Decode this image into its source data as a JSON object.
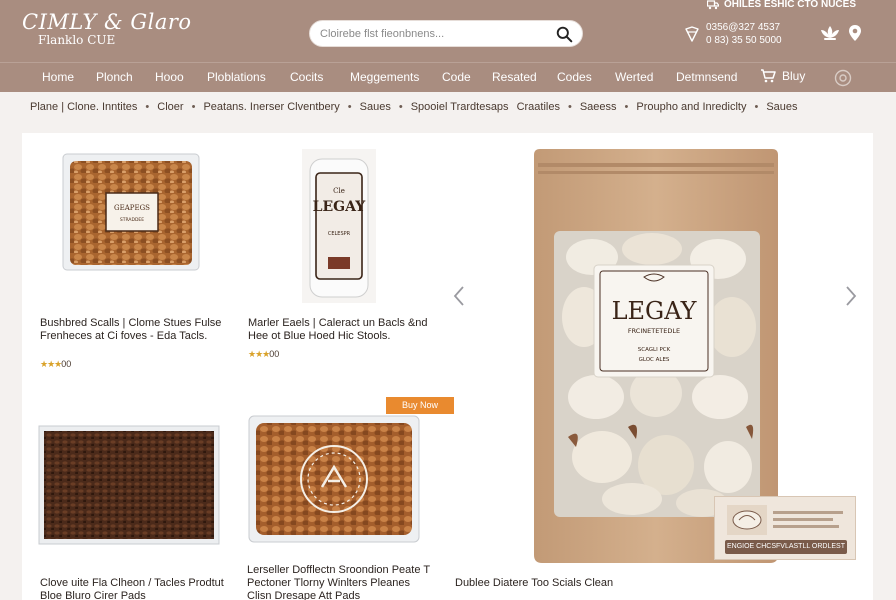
{
  "header": {
    "logo_title": "CIMLY & Glaro",
    "logo_subtitle": "Flanklo CUE",
    "search_placeholder": "Cloirebe flst fieonbnens...",
    "top_link": "OHILES ESHIC CTO NUCES",
    "phone_line1": "0356@327 4537",
    "phone_line2": "0 83) 35 50 5000"
  },
  "nav": {
    "items": [
      "Home",
      "Plonch",
      "Hooo",
      "Ploblations",
      "Cocits",
      "Meggements",
      "Code",
      "Resated",
      "Codes",
      "Werted",
      "Detmnsend"
    ],
    "cart_label": "Bluy"
  },
  "breadcrumb": {
    "items": [
      "Plane | Clone. Inntites",
      "Cloer",
      "Peatans. Inerser Clventbery",
      "Saues",
      "Spooiel Trardtesaps",
      "Craatiles",
      "Saeess",
      "Proupho and Inrediclty",
      "Saues"
    ]
  },
  "products": [
    {
      "name": "Bushbred Scalls | Clome Stues Fulse Frenheces at Ci foves - Eda Tacls.",
      "rating_stars": "★★★",
      "rating_value": "00"
    },
    {
      "name": "Marler Eaels | Caleract un Bacls &nd Hee ot Blue Hoed Hic Stools.",
      "rating_stars": "★★★",
      "rating_value": "00"
    },
    {
      "name": "Clove uite Fla Clheon / Tacles Prodtut Bloe Bluro Cirer Pads",
      "rating_stars": "",
      "rating_value": ""
    },
    {
      "name": "Lerseller Dofflectn Sroondion Peate T Pectoner Tlorny Winlters Pleanes Clisn Dresape Att Pads",
      "rating_stars": "",
      "rating_value": ""
    },
    {
      "name": "Dublee Diatere Too Scials Clean",
      "rating_stars": "",
      "rating_value": ""
    }
  ],
  "badge": {
    "label": "Buy Now"
  },
  "package_labels": {
    "bag1": "GEAPEGS",
    "bag1_sub": "STRADDEE",
    "bottle_top": "Cle",
    "bottle_main": "LEGAY",
    "bottle_sub": "CELESPR",
    "hero_main": "LEGAY",
    "hero_sub": "FRCINETETEDLE",
    "hero_small1": "SCAGLI PCK",
    "hero_small2": "GLOC ALES"
  },
  "thumbnail": {
    "label": "ENGIOE CHCSFVLASTLL ORDLEST"
  },
  "colors": {
    "header_bg": "#a98d80",
    "accent_orange": "#e98a2f",
    "star_gold": "#d9a22a",
    "kraft": "#c9a27e"
  },
  "icons": [
    "search-icon",
    "truck-icon",
    "phone-icon",
    "lotus-icon",
    "location-pin-icon",
    "cart-icon",
    "settings-icon",
    "chevron-left-icon",
    "chevron-right-icon"
  ]
}
